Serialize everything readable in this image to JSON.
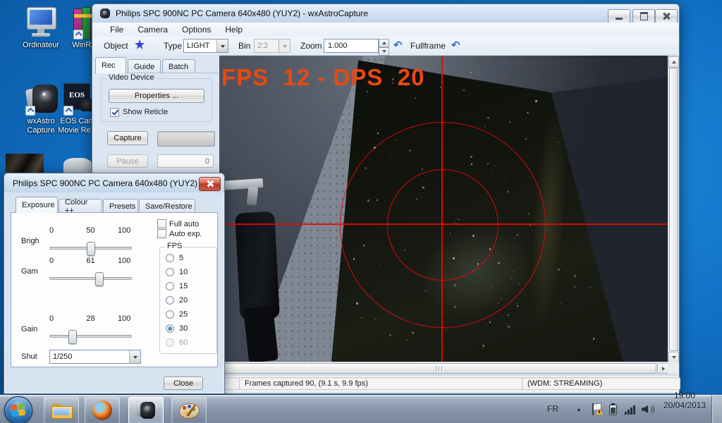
{
  "window": {
    "title": "Philips SPC 900NC PC Camera 640x480 (YUY2) - wxAstroCapture",
    "menu": {
      "file": "File",
      "camera": "Camera",
      "options": "Options",
      "help": "Help"
    },
    "toolbar": {
      "object_label": "Object",
      "type_label": "Type",
      "type_value": "LIGHT",
      "bin_label": "Bin",
      "bin_value": "2:2",
      "zoom_label": "Zoom",
      "zoom_value": "1.000",
      "fullframe_label": "Fullframe"
    },
    "tabs": {
      "rec": "Rec",
      "guide": "Guide",
      "batch": "Batch"
    },
    "rec_panel": {
      "group_title": "Video Device",
      "properties_button": "Properties ...",
      "show_reticle": "Show Reticle",
      "capture_button": "Capture",
      "pause_button": "Pause",
      "pause_count": "0"
    },
    "video": {
      "overlay": "FPS  12 - DPS  20"
    },
    "status": {
      "left": "Frames captured 90, (9.1 s, 9.9 fps)",
      "right": "(WDM: STREAMING)"
    }
  },
  "dialog": {
    "title": "Philips SPC 900NC PC Camera 640x480 (YUY2)",
    "tabs": {
      "exposure": "Exposure",
      "colour": "Colour ++",
      "presets": "Presets",
      "save": "Save/Restore"
    },
    "sliders": [
      {
        "label": "Brigh",
        "min": "0",
        "value": "50",
        "max": "100",
        "pos": 50
      },
      {
        "label": "Gam",
        "min": "0",
        "value": "61",
        "max": "100",
        "pos": 61
      },
      {
        "label": "Gain",
        "min": "0",
        "value": "28",
        "max": "100",
        "pos": 28
      }
    ],
    "shut": {
      "label": "Shut",
      "value": "1/250"
    },
    "full_auto": "Full auto",
    "auto_exp": "Auto exp.",
    "fps_group": {
      "title": "FPS",
      "options": [
        {
          "label": "5"
        },
        {
          "label": "10"
        },
        {
          "label": "15"
        },
        {
          "label": "20"
        },
        {
          "label": "25"
        },
        {
          "label": "30",
          "selected": true
        },
        {
          "label": "60",
          "disabled": true
        }
      ]
    },
    "close_button": "Close"
  },
  "desktop": {
    "icons": [
      {
        "label": "Ordinateur"
      },
      {
        "label": "WinRA..."
      },
      {
        "label": "wxAstro Capture"
      },
      {
        "label": "EOS Cam Movie Re..."
      }
    ]
  },
  "taskbar": {
    "tray": {
      "lang": "FR",
      "time": "19:00",
      "date": "20/04/2013"
    }
  },
  "icons": {
    "object_star": "★",
    "undo_arrow": "↶",
    "tray_expand": "▲"
  },
  "colors": {
    "reticle": "#e60a0a",
    "overlay_text": "#e8490f",
    "desktop_blue": "#1173c8",
    "dialog_close_red": "#c85a43"
  }
}
